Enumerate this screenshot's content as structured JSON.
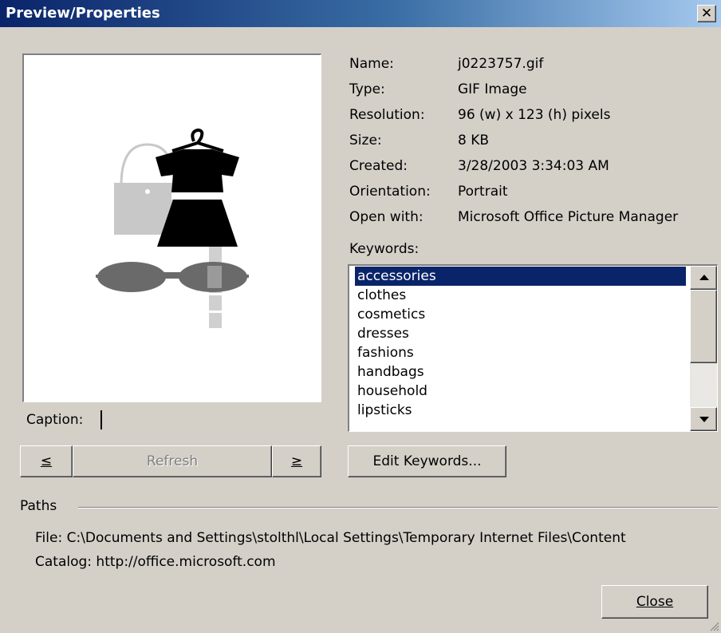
{
  "window": {
    "title": "Preview/Properties",
    "close_glyph": "X"
  },
  "properties": [
    {
      "label": "Name:",
      "value": "j0223757.gif"
    },
    {
      "label": "Type:",
      "value": "GIF Image"
    },
    {
      "label": "Resolution:",
      "value": "96 (w) x 123 (h) pixels"
    },
    {
      "label": "Size:",
      "value": "8 KB"
    },
    {
      "label": "Created:",
      "value": "3/28/2003 3:34:03 AM"
    },
    {
      "label": "Orientation:",
      "value": "Portrait"
    },
    {
      "label": "Open with:",
      "value": "Microsoft Office Picture Manager"
    }
  ],
  "keywords": {
    "label": "Keywords:",
    "selected": "accessories",
    "items": [
      "accessories",
      "clothes",
      "cosmetics",
      "dresses",
      "fashions",
      "handbags",
      "household",
      "lipsticks"
    ]
  },
  "caption": {
    "label": "Caption:",
    "value": ""
  },
  "buttons": {
    "prev": "≤",
    "refresh": "Refresh",
    "next": "≥",
    "edit_keywords": "Edit Keywords...",
    "close": "Close"
  },
  "paths": {
    "label": "Paths",
    "file": "File: C:\\Documents and Settings\\stolthl\\Local Settings\\Temporary Internet Files\\Content",
    "catalog": "Catalog: http://office.microsoft.com"
  },
  "colors": {
    "dialog_bg": "#d4d0c8",
    "title_gradient_start": "#0a246a",
    "title_gradient_end": "#a6caf0",
    "selection": "#0a246a"
  }
}
